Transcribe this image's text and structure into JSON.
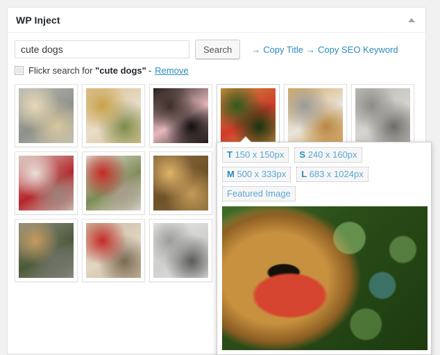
{
  "panel": {
    "title": "WP Inject",
    "toggle_icon": "chevron-up-icon",
    "toggle_color": "#a0a5aa"
  },
  "search": {
    "value": "cute dogs",
    "placeholder": "Search",
    "button_label": "Search"
  },
  "copy_links": [
    {
      "arrow": "→",
      "label": "Copy Title"
    },
    {
      "arrow": "→",
      "label": "Copy SEO Keyword"
    }
  ],
  "flickr": {
    "checkbox_checked": false,
    "prefix": "Flickr search for ",
    "query": "\"cute dogs\"",
    "separator": "-",
    "remove_label": "Remove"
  },
  "colors": {
    "link": "#2b8cbe",
    "page_bg": "#f1f1f1",
    "panel_bg": "#ffffff",
    "panel_border": "#e5e5e5",
    "title": "#23282d",
    "size_btn_text": "#5aa7d4"
  },
  "popup": {
    "visible": true,
    "anchor_thumb_index": 3,
    "size_buttons": [
      {
        "prefix": "T",
        "label": "150 x 150px"
      },
      {
        "prefix": "S",
        "label": "240 x 160px"
      },
      {
        "prefix": "M",
        "label": "500 x 333px"
      },
      {
        "prefix": "L",
        "label": "683 x 1024px"
      }
    ],
    "featured_label": "Featured Image",
    "preview_alt": "yorkshire-terrier-with-tongue-out"
  },
  "grid": {
    "columns": 6,
    "thumbs": [
      {
        "alt": "two-small-dogs-on-tiled-floor",
        "c1": "#b9bbb4",
        "c2": "#e8d9b6",
        "c3": "#8e9189",
        "c4": "#d8c79d"
      },
      {
        "alt": "jack-russell-puppy-on-step",
        "c1": "#d8bf8a",
        "c2": "#c8a24a",
        "c3": "#e9dccb",
        "c4": "#7e8b4a"
      },
      {
        "alt": "black-pug-closeup",
        "c1": "#221c1a",
        "c2": "#3b2e28",
        "c3": "#e7b9bd",
        "c4": "#120f0e"
      },
      {
        "alt": "yorkie-with-red-tongue",
        "c1": "#c8913f",
        "c2": "#2f5a1c",
        "c3": "#d23a2a",
        "c4": "#17350e"
      },
      {
        "alt": "golden-puppy-lying-on-stone",
        "c1": "#d8a85d",
        "c2": "#9a9a97",
        "c3": "#e8e4dc",
        "c4": "#b8873f"
      },
      {
        "alt": "grey-terrier-on-leash",
        "c1": "#b9b7b2",
        "c2": "#8d8b86",
        "c3": "#d6d4cf",
        "c4": "#6f6d69"
      },
      {
        "alt": "shih-tzu-held-in-arms",
        "c1": "#d8c3bb",
        "c2": "#eadfd8",
        "c3": "#b4262b",
        "c4": "#9c8279"
      },
      {
        "alt": "white-terrier-in-red-harness",
        "c1": "#e3e0d6",
        "c2": "#c52a26",
        "c3": "#7d8a54",
        "c4": "#a99e8e"
      },
      {
        "alt": "fluffy-tan-pomeranian-indoors",
        "c1": "#8a6a3e",
        "c2": "#e0b469",
        "c3": "#6d5128",
        "c4": "#c49a57"
      },
      {
        "alt": "black-and-tan-dog-on-floor",
        "c1": "#241f1d",
        "c2": "#8d2b3a",
        "c3": "#55433c",
        "c4": "#1a1615"
      },
      {
        "alt": "two-french-bulldogs-on-beach",
        "c1": "#b8ad9c",
        "c2": "#6b6f72",
        "c3": "#d6cfc2",
        "c4": "#3f4447"
      },
      {
        "alt": "puppies-in-basket-with-toys",
        "c1": "#c8c24e",
        "c2": "#e6e2d2",
        "c3": "#2f6fa8",
        "c4": "#8a8f3e"
      },
      {
        "alt": "spaniel-puppy-by-chain-fence",
        "c1": "#8d8f84",
        "c2": "#c59a5e",
        "c3": "#4c5a3a",
        "c4": "#6f7268"
      },
      {
        "alt": "labrador-sleeping-on-carpet",
        "c1": "#c9b79c",
        "c2": "#c32a26",
        "c3": "#e1d6c4",
        "c4": "#7c6a52"
      },
      {
        "alt": "white-westie-by-lattice-fence",
        "c1": "#e7e7e5",
        "c2": "#9d9d9b",
        "c3": "#cfcfcd",
        "c4": "#5c5c5a"
      },
      {
        "alt": "brown-dog-on-dirt-path",
        "c1": "#bfa481",
        "c2": "#8d7553",
        "c3": "#d9c7aa",
        "c4": "#6d5b3e"
      },
      {
        "alt": "dog-in-green-grass",
        "c1": "#4f7a33",
        "c2": "#8aa65a",
        "c3": "#2e4d1e",
        "c4": "#c8c07a"
      },
      {
        "alt": "dog-walking-on-pavement",
        "c1": "#b4b4b2",
        "c2": "#8f8f8d",
        "c3": "#d3623a",
        "c4": "#6e6e6c"
      }
    ]
  }
}
